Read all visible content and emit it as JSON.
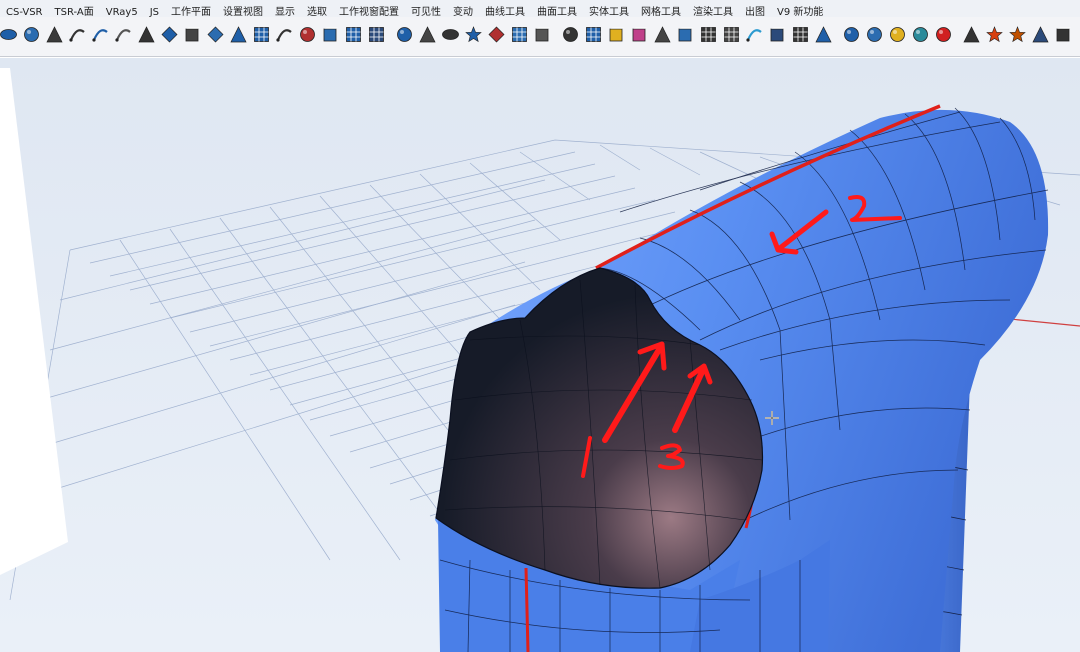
{
  "menubar": {
    "items": [
      "CS-VSR",
      "TSR-A面",
      "VRay5",
      "JS",
      "工作平面",
      "设置视图",
      "显示",
      "选取",
      "工作视窗配置",
      "可见性",
      "变动",
      "曲线工具",
      "曲面工具",
      "实体工具",
      "网格工具",
      "渲染工具",
      "出图",
      "V9 新功能"
    ]
  },
  "toolbar": {
    "icons": [
      {
        "name": "ellipsoid-icon",
        "shape": "ellipse",
        "fill": "#1f5fa8"
      },
      {
        "name": "sphere-icon",
        "shape": "circle",
        "fill": "#2b6cb0"
      },
      {
        "name": "lamp-icon",
        "shape": "tri",
        "fill": "#3a3a3a"
      },
      {
        "name": "curve-point-icon",
        "shape": "arc",
        "fill": "#333"
      },
      {
        "name": "curve-from-2-views-icon",
        "shape": "arc",
        "fill": "#1f5fa8"
      },
      {
        "name": "trim-curve-icon",
        "shape": "arc",
        "fill": "#555"
      },
      {
        "name": "split-icon",
        "shape": "tri",
        "fill": "#333"
      },
      {
        "name": "surface-patch-icon",
        "shape": "diamond",
        "fill": "#1f5fa8"
      },
      {
        "name": "extrude-icon",
        "shape": "square",
        "fill": "#444"
      },
      {
        "name": "rebuild-icon",
        "shape": "diamond",
        "fill": "#2b6cb0"
      },
      {
        "name": "pen-icon",
        "shape": "tri",
        "fill": "#1f5fa8"
      },
      {
        "name": "grid-surface-icon",
        "shape": "grid",
        "fill": "#1f5fa8"
      },
      {
        "name": "blend-curve-icon",
        "shape": "arc",
        "fill": "#333"
      },
      {
        "name": "connect-icon",
        "shape": "circle",
        "fill": "#b03030"
      },
      {
        "name": "box-icon",
        "shape": "square",
        "fill": "#2b6cb0"
      },
      {
        "name": "mesh-box-icon",
        "shape": "grid",
        "fill": "#1f5fa8"
      },
      {
        "name": "film-icon",
        "shape": "grid",
        "fill": "#2b4a7a"
      },
      {
        "name": "globe-icon",
        "shape": "circle",
        "fill": "#1f5fa8"
      },
      {
        "name": "bridge-icon",
        "shape": "tri",
        "fill": "#444"
      },
      {
        "name": "dumbbell-icon",
        "shape": "ellipse",
        "fill": "#333"
      },
      {
        "name": "star-icon",
        "shape": "star",
        "fill": "#1f5fa8"
      },
      {
        "name": "project-icon",
        "shape": "diamond",
        "fill": "#b03030"
      },
      {
        "name": "checker-icon",
        "shape": "grid",
        "fill": "#2b6cb0"
      },
      {
        "name": "dock-icon",
        "shape": "square",
        "fill": "#555"
      },
      {
        "name": "rotate-icon",
        "shape": "circle",
        "fill": "#333"
      },
      {
        "name": "wire-grid-icon",
        "shape": "grid",
        "fill": "#1f5fa8"
      },
      {
        "name": "gold-cube-icon",
        "shape": "square",
        "fill": "#e0b020"
      },
      {
        "name": "pink-cube-icon",
        "shape": "square",
        "fill": "#c0408a"
      },
      {
        "name": "bench-icon",
        "shape": "tri",
        "fill": "#444"
      },
      {
        "name": "blue-cube-icon",
        "shape": "square",
        "fill": "#2b6cb0"
      },
      {
        "name": "dots-grid-icon",
        "shape": "grid",
        "fill": "#333"
      },
      {
        "name": "dark-grid-icon",
        "shape": "grid",
        "fill": "#444"
      },
      {
        "name": "hook-icon",
        "shape": "arc",
        "fill": "#2b9ad0"
      },
      {
        "name": "layers-icon",
        "shape": "square",
        "fill": "#2b4a7a"
      },
      {
        "name": "list-icon",
        "shape": "grid",
        "fill": "#333"
      },
      {
        "name": "tools-icon",
        "shape": "tri",
        "fill": "#1f5fa8"
      },
      {
        "name": "gears-icon",
        "shape": "circle",
        "fill": "#1f5fa8"
      },
      {
        "name": "circle-blue-icon",
        "shape": "circle",
        "fill": "#2b6cb0"
      },
      {
        "name": "circle-yellow-icon",
        "shape": "circle",
        "fill": "#e0b020"
      },
      {
        "name": "circle-teal-icon",
        "shape": "circle",
        "fill": "#2b8a9a"
      },
      {
        "name": "no-entry-icon",
        "shape": "circle",
        "fill": "#d02020"
      },
      {
        "name": "scissors-icon",
        "shape": "tri",
        "fill": "#333"
      },
      {
        "name": "red-puzzle-icon",
        "shape": "star",
        "fill": "#d84010"
      },
      {
        "name": "gear-puzzle-icon",
        "shape": "star",
        "fill": "#c05000"
      },
      {
        "name": "house-icon",
        "shape": "tri",
        "fill": "#2b4a7a"
      },
      {
        "name": "frame-icon",
        "shape": "square",
        "fill": "#333"
      }
    ]
  },
  "viewport": {
    "annotations": {
      "stroke_color": "#ff1a1a",
      "labels": [
        "2",
        "1",
        "3"
      ]
    },
    "surface_color": "#4f86f0",
    "grid_color": "#8fa3c4",
    "background_top": "#dde6f2",
    "background_bottom": "#eaf0f8"
  }
}
